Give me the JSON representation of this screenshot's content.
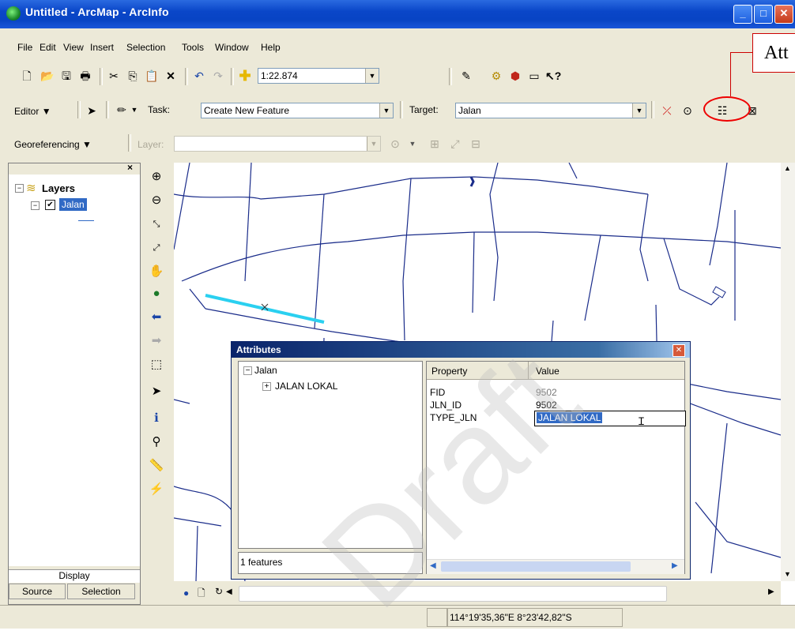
{
  "window": {
    "title": "Untitled - ArcMap - ArcInfo",
    "minimize": "_",
    "maximize": "□",
    "close": "✕"
  },
  "menu": [
    "File",
    "Edit",
    "View",
    "Insert",
    "Selection",
    "Tools",
    "Window",
    "Help"
  ],
  "standard_toolbar": {
    "scale": "1:22.874"
  },
  "editor_toolbar": {
    "editor_label": "Editor",
    "task_label": "Task:",
    "task_value": "Create New Feature",
    "target_label": "Target:",
    "target_value": "Jalan"
  },
  "georef_toolbar": {
    "label": "Georeferencing",
    "layer_label": "Layer:"
  },
  "callout": {
    "text": "Att"
  },
  "toc": {
    "root": "Layers",
    "layer": "Jalan",
    "tabs": [
      "Display",
      "Source",
      "Selection"
    ]
  },
  "dialog": {
    "title": "Attributes",
    "tree_root": "Jalan",
    "tree_child": "JALAN LOKAL",
    "footer": "1 features",
    "headers": [
      "Property",
      "Value"
    ],
    "rows": [
      {
        "property": "FID",
        "value": "9502"
      },
      {
        "property": "JLN_ID",
        "value": "9502"
      },
      {
        "property": "TYPE_JLN",
        "value": "JALAN LOKAL"
      }
    ]
  },
  "status": {
    "coords": "114°19'35,36\"E  8°23'42,82\"S"
  },
  "watermark": "Draft"
}
